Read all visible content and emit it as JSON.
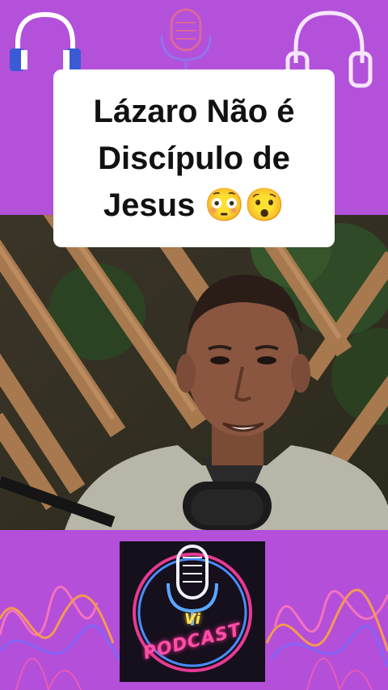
{
  "title_card": {
    "line1": "Lázaro Não é",
    "line2": "Discípulo de",
    "line3": "Jesus 😳😯"
  },
  "logo": {
    "vi_text": "Vi",
    "podcast_text": "PODCAST"
  },
  "colors": {
    "background": "#b44fd9",
    "card": "#ffffff",
    "neon_pink": "#ff4fa8",
    "neon_blue": "#5aa8ff",
    "neon_yellow": "#ffe45a"
  },
  "icons": [
    "headphones-icon",
    "headphones-icon",
    "microphone-icon"
  ]
}
